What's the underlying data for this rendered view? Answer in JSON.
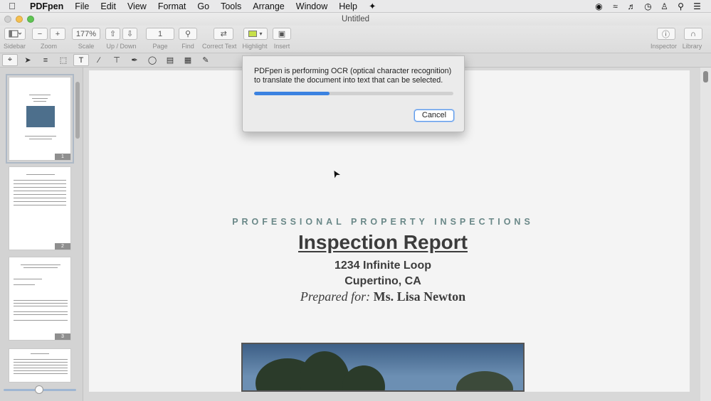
{
  "menubar": {
    "app_name": "PDFpen",
    "items": [
      "File",
      "Edit",
      "View",
      "Format",
      "Go",
      "Tools",
      "Arrange",
      "Window",
      "Help"
    ],
    "status_icons": [
      "record-icon",
      "wifi-icon",
      "volume-icon",
      "clock-icon",
      "user-icon",
      "spotlight-icon",
      "notification-icon"
    ]
  },
  "window": {
    "title": "Untitled"
  },
  "toolbar": {
    "sidebar_label": "Sidebar",
    "zoom_label": "Zoom",
    "zoom_out": "−",
    "zoom_in": "+",
    "scale_value": "177%",
    "scale_label": "Scale",
    "updown_label": "Up / Down",
    "page_value": "1",
    "page_label": "Page",
    "find_label": "Find",
    "correct_text_label": "Correct Text",
    "highlight_label": "Highlight",
    "highlight_color": "#c7e04a",
    "insert_label": "Insert",
    "inspector_label": "Inspector",
    "library_label": "Library"
  },
  "sidebar": {
    "page_numbers": [
      "1",
      "2",
      "3"
    ],
    "zoom_slider_fraction": 0.46
  },
  "document": {
    "company": "PROFESSIONAL PROPERTY INSPECTIONS",
    "title": "Inspection Report",
    "address_line1": "1234 Infinite Loop",
    "address_line2": "Cupertino, CA",
    "prepared_label": "Prepared for:",
    "prepared_name": "Ms. Lisa Newton"
  },
  "ocr_dialog": {
    "message": "PDFpen is performing OCR (optical character recognition) to translate the document into text that can be selected.",
    "progress_fraction": 0.38,
    "cancel_label": "Cancel",
    "progress_color": "#3b82e0"
  }
}
